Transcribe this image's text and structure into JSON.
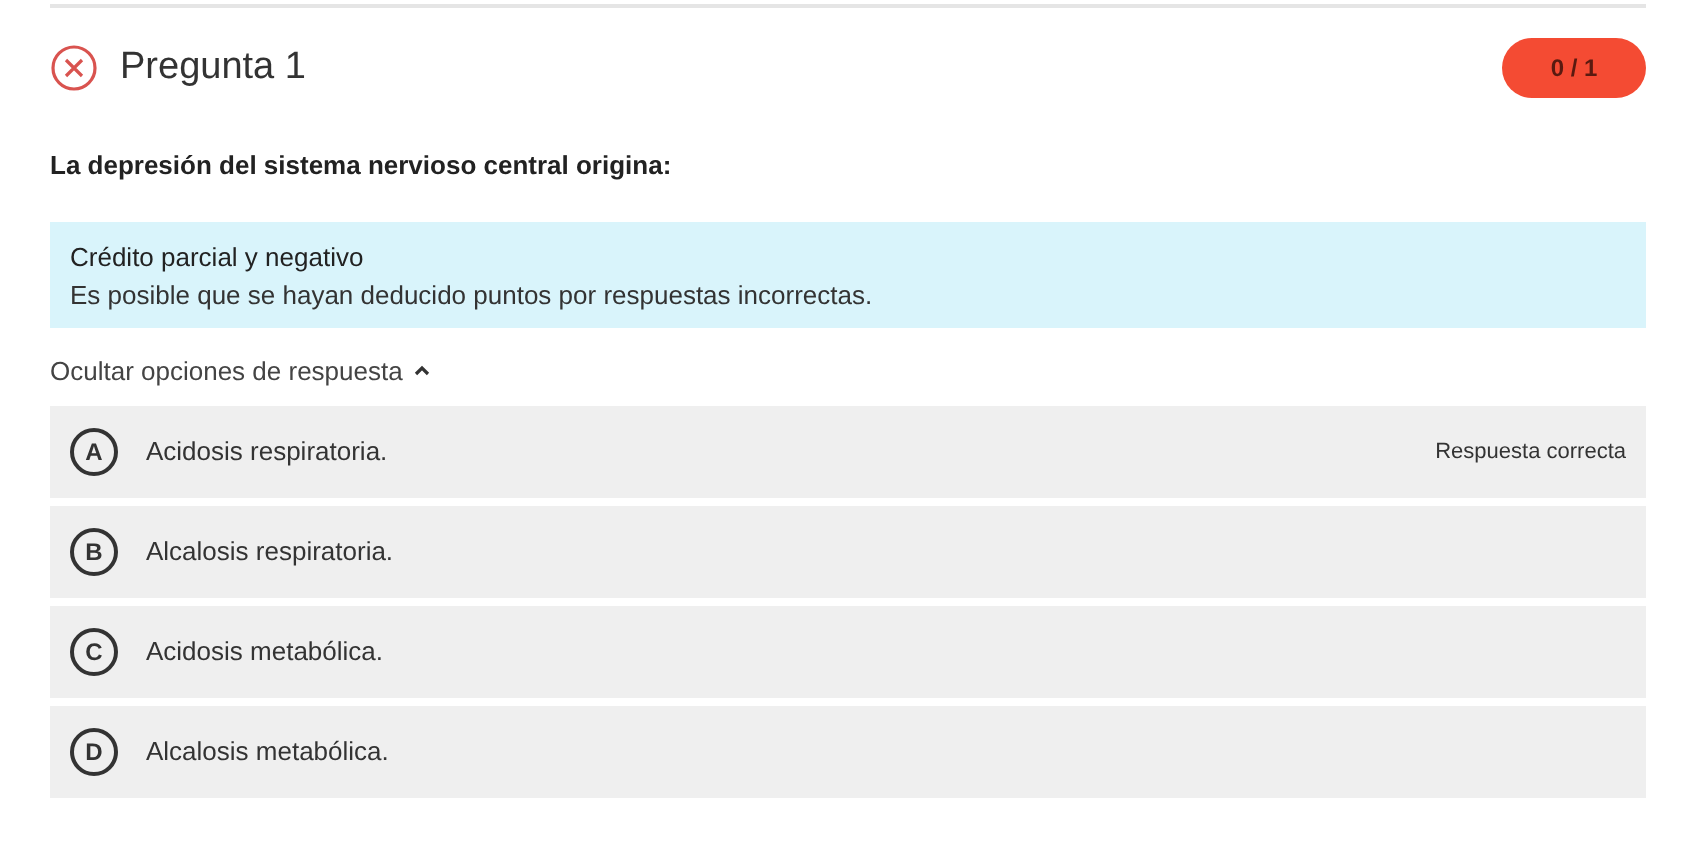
{
  "question": {
    "correct": false,
    "title": "Pregunta 1",
    "score": "0 / 1",
    "prompt": "La depresión del sistema nervioso central origina:"
  },
  "notice": {
    "title": "Crédito parcial y negativo",
    "text": "Es posible que se hayan deducido puntos por respuestas incorrectas."
  },
  "toggle": {
    "label": "Ocultar opciones de respuesta",
    "expanded": true
  },
  "options": [
    {
      "letter": "A",
      "text": "Acidosis respiratoria.",
      "note": "Respuesta correcta"
    },
    {
      "letter": "B",
      "text": "Alcalosis respiratoria."
    },
    {
      "letter": "C",
      "text": "Acidosis metabólica."
    },
    {
      "letter": "D",
      "text": "Alcalosis metabólica."
    }
  ]
}
